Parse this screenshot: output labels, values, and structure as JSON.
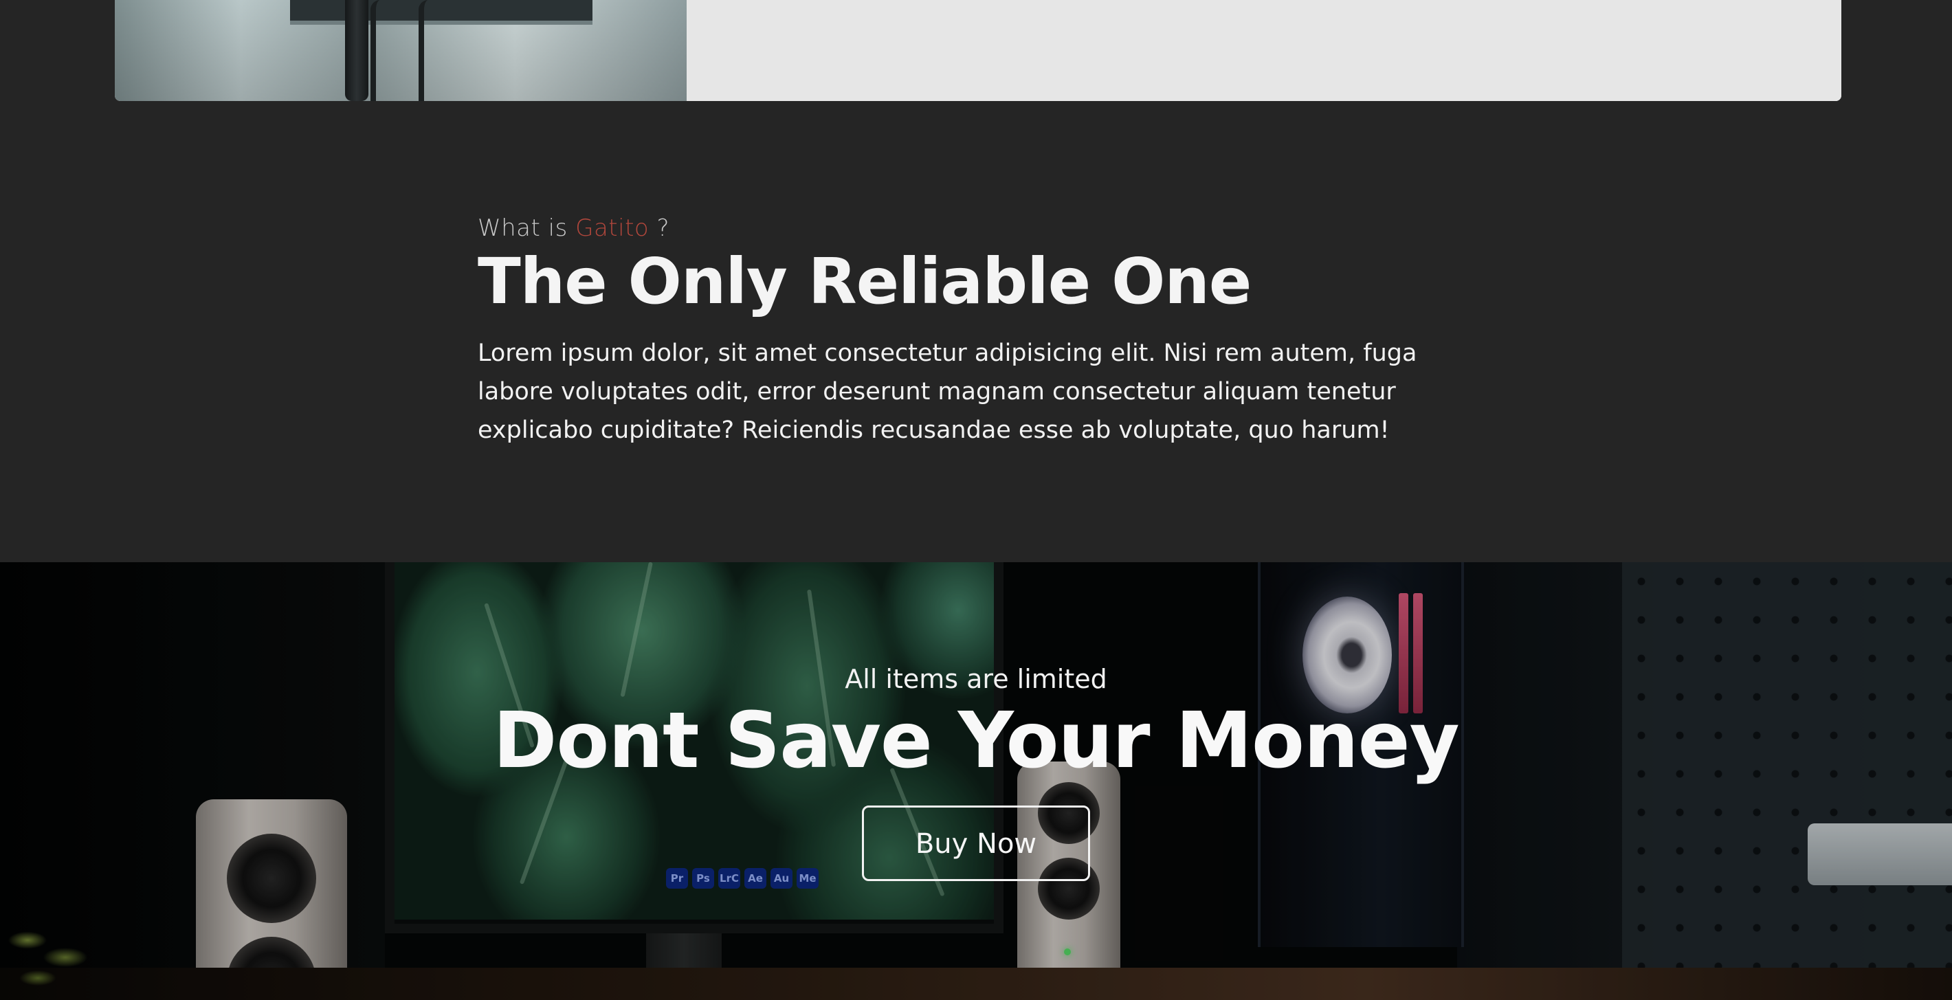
{
  "about": {
    "eyebrow_prefix": "What is",
    "eyebrow_brand": "Gatito",
    "eyebrow_suffix": "?",
    "headline": "The Only Reliable One",
    "body": "Lorem ipsum dolor, sit amet consectetur adipisicing elit. Nisi rem autem, fuga labore voluptates odit, error deserunt magnam consectetur aliquam tenetur explicabo cupiditate? Reiciendis recusandae esse ab voluptate, quo harum!"
  },
  "promo": {
    "eyebrow": "All items are limited",
    "title": "Dont Save Your Money",
    "button_label": "Buy Now"
  },
  "photo_dock_icons": [
    "Pr",
    "Ps",
    "LrC",
    "Ae",
    "Au",
    "Me"
  ],
  "colors": {
    "page_background": "#252525",
    "brand_accent": "#b2473c",
    "card_panel": "#e6e6e6",
    "text_light": "#f4f4f4"
  }
}
